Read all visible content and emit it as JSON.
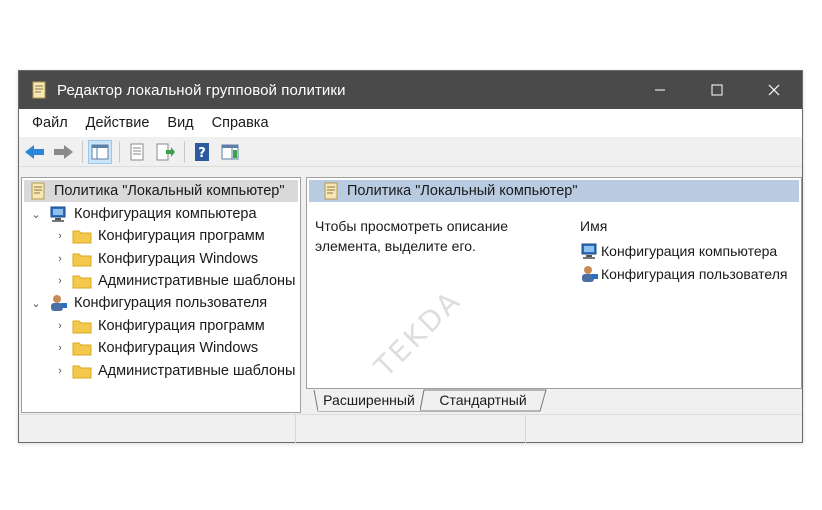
{
  "window": {
    "title": "Редактор локальной групповой политики"
  },
  "menu": [
    "Файл",
    "Действие",
    "Вид",
    "Справка"
  ],
  "tree": {
    "root": "Политика \"Локальный компьютер\"",
    "computer": {
      "label": "Конфигурация компьютера",
      "children": [
        "Конфигурация программ",
        "Конфигурация Windows",
        "Административные шаблоны"
      ]
    },
    "user": {
      "label": "Конфигурация пользователя",
      "children": [
        "Конфигурация программ",
        "Конфигурация Windows",
        "Административные шаблоны"
      ]
    }
  },
  "details": {
    "header": "Политика \"Локальный компьютер\"",
    "description": "Чтобы просмотреть описание элемента, выделите его.",
    "column_name": "Имя",
    "items": [
      "Конфигурация компьютера",
      "Конфигурация пользователя"
    ]
  },
  "tabs": [
    "Расширенный",
    "Стандартный"
  ],
  "watermark": "TEKDA",
  "colors": {
    "titlebar": "#4a4a4a",
    "selection": "#d9d9d9",
    "header": "#b9cbe0",
    "folder": "#f2c94c"
  }
}
